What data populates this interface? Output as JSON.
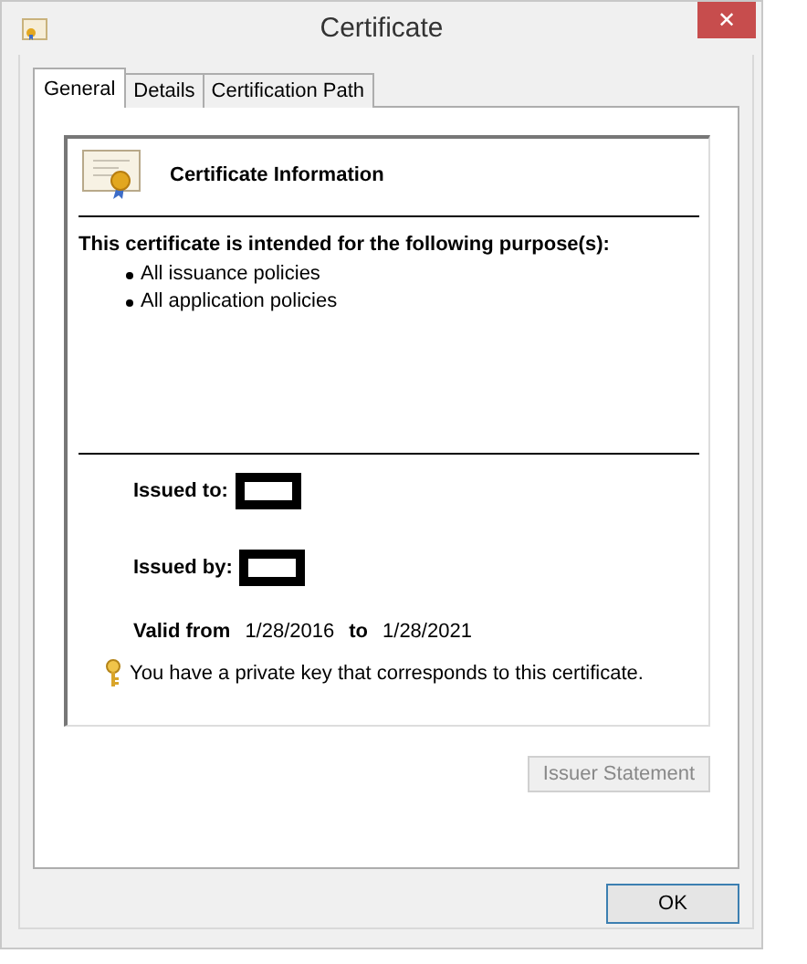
{
  "window": {
    "title": "Certificate",
    "close": "✕"
  },
  "tabs": [
    {
      "label": "General",
      "selected": true
    },
    {
      "label": "Details",
      "selected": false
    },
    {
      "label": "Certification Path",
      "selected": false
    }
  ],
  "info": {
    "heading": "Certificate Information",
    "purpose_intro": "This certificate is intended for the following purpose(s):",
    "purposes": [
      "All issuance policies",
      "All application policies"
    ],
    "issued_to": {
      "label": "Issued to:",
      "redacted": true
    },
    "issued_by": {
      "label": "Issued by:",
      "redacted": true
    },
    "valid_from_label": "Valid from",
    "valid_from": "1/28/2016",
    "valid_to_label": "to",
    "valid_to": "1/28/2021",
    "private_key_note": "You have a private key that corresponds to this certificate."
  },
  "issuer_statement": {
    "label": "Issuer Statement",
    "disabled": true
  },
  "buttons": [
    "OK"
  ]
}
